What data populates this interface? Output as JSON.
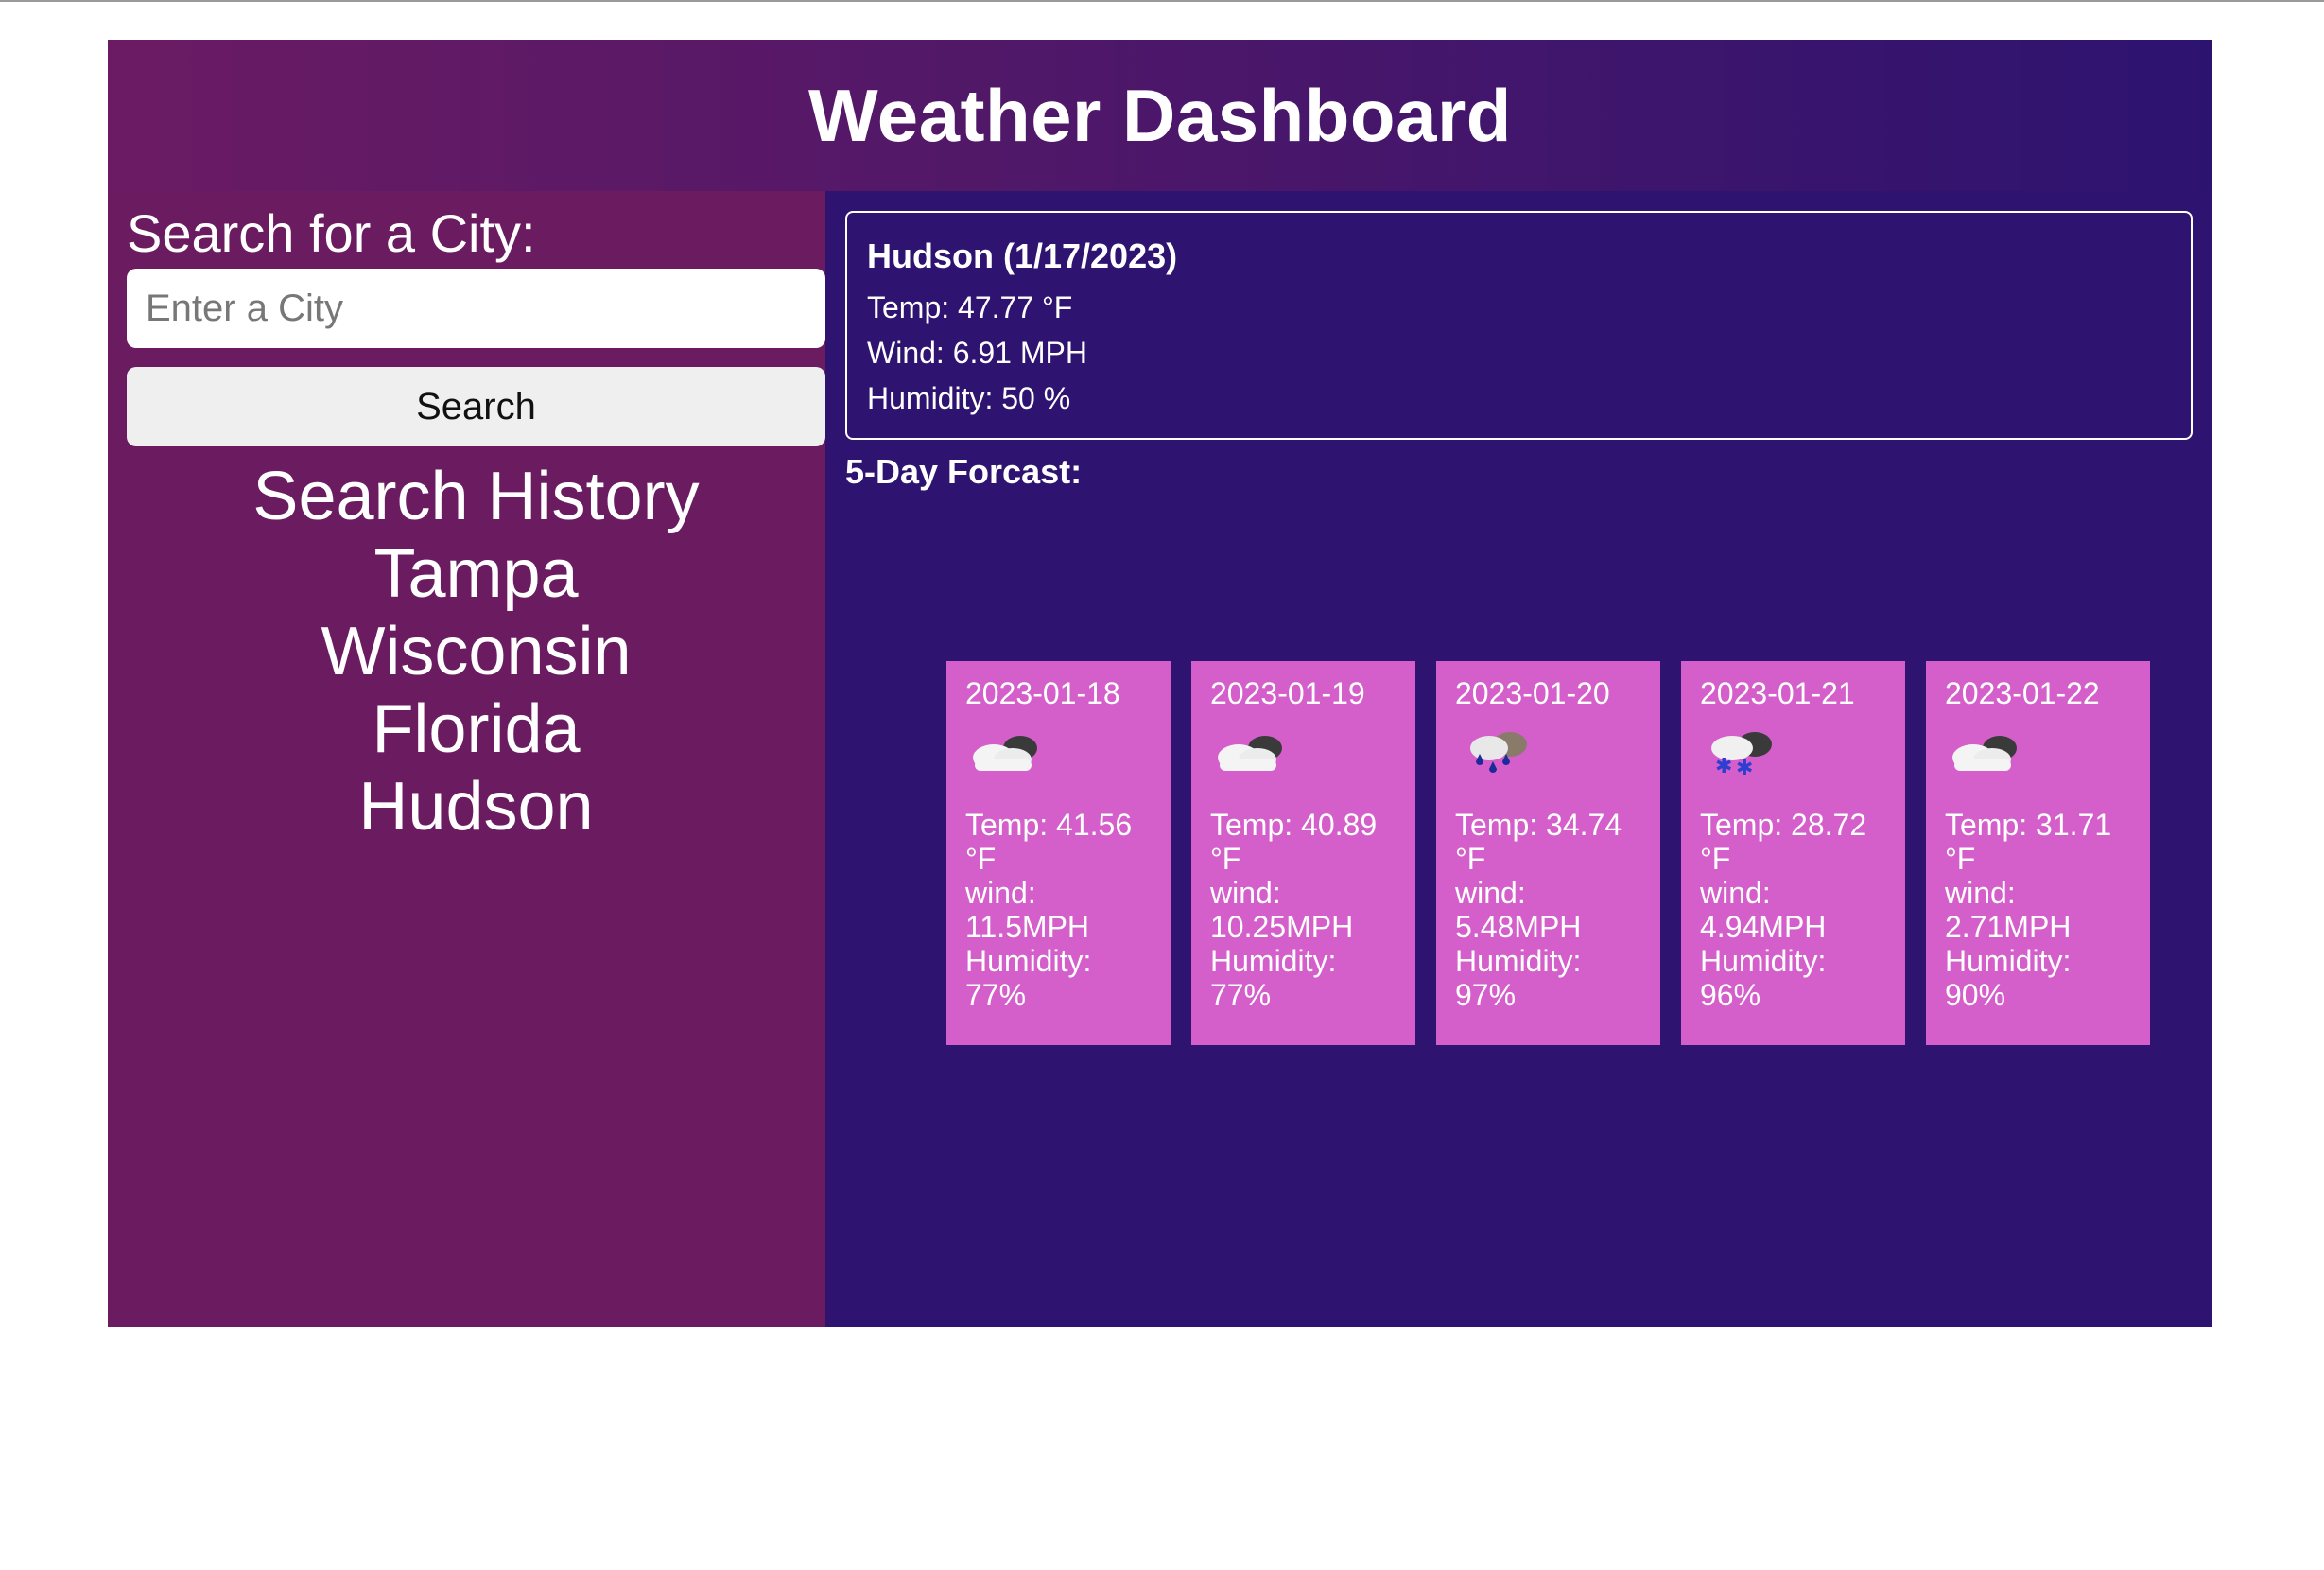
{
  "header": {
    "title": "Weather Dashboard"
  },
  "sidebar": {
    "search_label": "Search for a City:",
    "search_placeholder": "Enter a City",
    "search_value": "",
    "search_button": "Search",
    "history_title": "Search History",
    "history": [
      "Tampa",
      "Wisconsin",
      "Florida",
      "Hudson"
    ]
  },
  "current": {
    "title": "Hudson (1/17/2023)",
    "temp": "Temp: 47.77 °F",
    "wind": "Wind: 6.91 MPH",
    "humidity": "Humidity: 50 %"
  },
  "forecast": {
    "title": "5-Day Forcast:",
    "days": [
      {
        "date": "2023-01-18",
        "icon": "cloudy-icon",
        "temp": "Temp: 41.56",
        "temp_unit": "°F",
        "wind_label": "wind:",
        "wind": "11.5MPH",
        "humidity_label": "Humidity:",
        "humidity": "77%"
      },
      {
        "date": "2023-01-19",
        "icon": "cloudy-icon",
        "temp": "Temp: 40.89",
        "temp_unit": "°F",
        "wind_label": "wind:",
        "wind": "10.25MPH",
        "humidity_label": "Humidity:",
        "humidity": "77%"
      },
      {
        "date": "2023-01-20",
        "icon": "rain-icon",
        "temp": "Temp: 34.74",
        "temp_unit": "°F",
        "wind_label": "wind:",
        "wind": "5.48MPH",
        "humidity_label": "Humidity:",
        "humidity": "97%"
      },
      {
        "date": "2023-01-21",
        "icon": "snow-icon",
        "temp": "Temp: 28.72",
        "temp_unit": "°F",
        "wind_label": "wind:",
        "wind": "4.94MPH",
        "humidity_label": "Humidity:",
        "humidity": "96%"
      },
      {
        "date": "2023-01-22",
        "icon": "cloudy-icon",
        "temp": "Temp: 31.71",
        "temp_unit": "°F",
        "wind_label": "wind:",
        "wind": "2.71MPH",
        "humidity_label": "Humidity:",
        "humidity": "90%"
      }
    ]
  },
  "colors": {
    "header_gradient_start": "#6b1b63",
    "header_gradient_end": "#2d1370",
    "sidebar_bg": "#6b1c61",
    "main_bg": "#2e1370",
    "card_bg": "#d45fca"
  }
}
